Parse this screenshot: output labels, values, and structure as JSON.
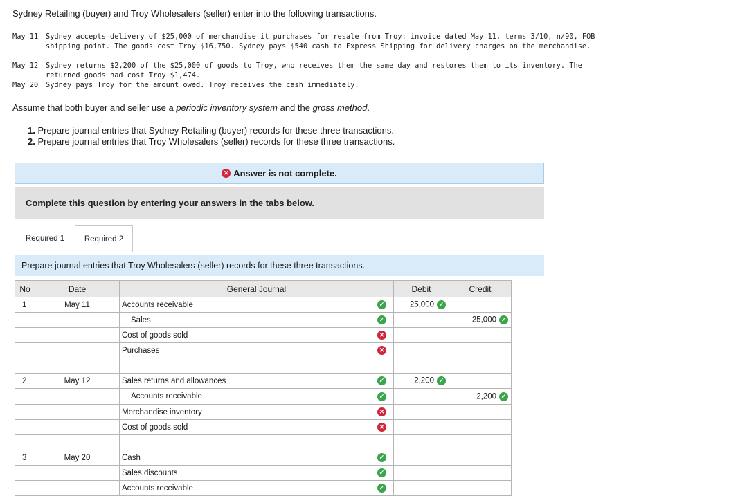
{
  "intro": "Sydney Retailing (buyer) and Troy Wholesalers (seller) enter into the following transactions.",
  "transactions": [
    {
      "date": "May 11",
      "text": "Sydney accepts delivery of $25,000 of merchandise it purchases for resale from Troy: invoice dated May 11, terms 3/10, n/90, FOB shipping point. The goods cost Troy $16,750. Sydney pays $540 cash to Express Shipping for delivery charges on the merchandise."
    },
    {
      "date": "May 12",
      "text": "Sydney returns $2,200 of the $25,000 of goods to Troy, who receives them the same day and restores them to its inventory. The returned goods had cost Troy $1,474."
    },
    {
      "date": "May 20",
      "text": "Sydney pays Troy for the amount owed. Troy receives the cash immediately."
    }
  ],
  "assumption": {
    "pre": "Assume that both buyer and seller use a ",
    "i1": "periodic inventory system",
    "mid": " and the ",
    "i2": "gross method",
    "post": "."
  },
  "requirements": [
    {
      "num": "1.",
      "text": " Prepare journal entries that Sydney Retailing (buyer) records for these three transactions."
    },
    {
      "num": "2.",
      "text": " Prepare journal entries that Troy Wholesalers (seller) records for these three transactions."
    }
  ],
  "status_banner": "Answer is not complete.",
  "instructions_banner": "Complete this question by entering your answers in the tabs below.",
  "tabs": [
    "Required 1",
    "Required 2"
  ],
  "prompt": "Prepare journal entries that Troy Wholesalers (seller) records for these three transactions.",
  "table": {
    "headers": {
      "no": "No",
      "date": "Date",
      "journal": "General Journal",
      "debit": "Debit",
      "credit": "Credit"
    },
    "rows": [
      {
        "no": "1",
        "date": "May 11",
        "account": "Accounts receivable",
        "indent": false,
        "status": "ok",
        "debit": "25,000",
        "credit": ""
      },
      {
        "no": "",
        "date": "",
        "account": "Sales",
        "indent": true,
        "status": "ok",
        "debit": "",
        "credit": "25,000"
      },
      {
        "no": "",
        "date": "",
        "account": "Cost of goods sold",
        "indent": false,
        "status": "bad",
        "debit": "",
        "credit": ""
      },
      {
        "no": "",
        "date": "",
        "account": "Purchases",
        "indent": false,
        "status": "bad",
        "debit": "",
        "credit": ""
      },
      {
        "no": "",
        "date": "",
        "account": "",
        "indent": false,
        "status": "",
        "debit": "",
        "credit": ""
      },
      {
        "no": "2",
        "date": "May 12",
        "account": "Sales returns and allowances",
        "indent": false,
        "status": "ok",
        "debit": "2,200",
        "credit": ""
      },
      {
        "no": "",
        "date": "",
        "account": "Accounts receivable",
        "indent": true,
        "status": "ok",
        "debit": "",
        "credit": "2,200"
      },
      {
        "no": "",
        "date": "",
        "account": "Merchandise inventory",
        "indent": false,
        "status": "bad",
        "debit": "",
        "credit": ""
      },
      {
        "no": "",
        "date": "",
        "account": "Cost of goods sold",
        "indent": false,
        "status": "bad",
        "debit": "",
        "credit": ""
      },
      {
        "no": "",
        "date": "",
        "account": "",
        "indent": false,
        "status": "",
        "debit": "",
        "credit": ""
      },
      {
        "no": "3",
        "date": "May 20",
        "account": "Cash",
        "indent": false,
        "status": "ok",
        "debit": "",
        "credit": ""
      },
      {
        "no": "",
        "date": "",
        "account": "Sales discounts",
        "indent": false,
        "status": "ok",
        "debit": "",
        "credit": ""
      },
      {
        "no": "",
        "date": "",
        "account": "Accounts receivable",
        "indent": false,
        "status": "ok",
        "debit": "",
        "credit": ""
      }
    ]
  },
  "icons": {
    "ok": "check-circle-icon",
    "bad": "x-circle-icon"
  },
  "colors": {
    "ok": "#3aa54a",
    "bad": "#d0253a",
    "banner_blue": "#d9ebf9",
    "banner_gray": "#e1e1e1"
  }
}
